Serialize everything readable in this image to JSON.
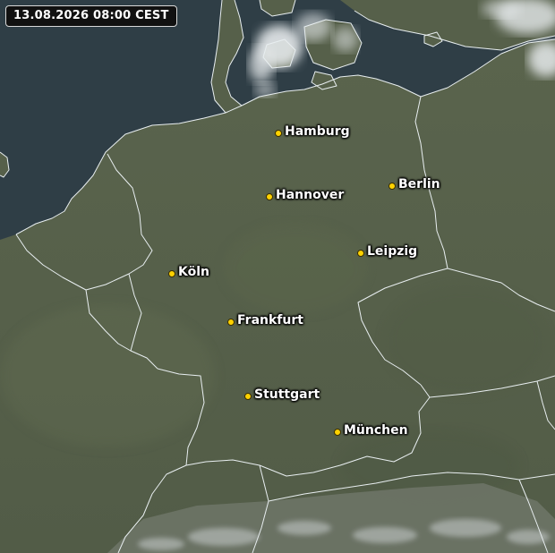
{
  "timestamp": "13.08.2026 08:00 CEST",
  "colors": {
    "sea": "#2f3e46",
    "land": "#56604a",
    "border": "#e8eef0",
    "city_dot": "#ffd200",
    "cloud": "#e6eaec"
  },
  "cities": [
    {
      "name": "Hamburg"
    },
    {
      "name": "Berlin"
    },
    {
      "name": "Hannover"
    },
    {
      "name": "Leipzig"
    },
    {
      "name": "Köln"
    },
    {
      "name": "Frankfurt"
    },
    {
      "name": "Stuttgart"
    },
    {
      "name": "München"
    }
  ]
}
